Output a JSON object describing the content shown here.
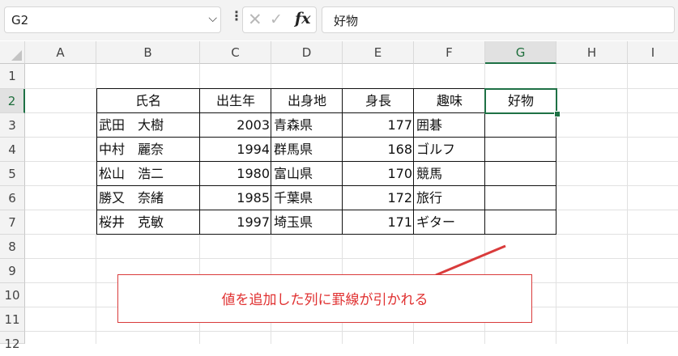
{
  "formula_bar": {
    "name_box": "G2",
    "cancel_icon": "✕",
    "enter_icon": "✓",
    "fx_label": "fx",
    "formula_value": "好物"
  },
  "columns": [
    "A",
    "B",
    "C",
    "D",
    "E",
    "F",
    "G",
    "H",
    "I"
  ],
  "rows": [
    "1",
    "2",
    "3",
    "4",
    "5",
    "6",
    "7",
    "8",
    "9",
    "10",
    "11",
    "12"
  ],
  "selected_cell": "G2",
  "table": {
    "headers": [
      "氏名",
      "出生年",
      "出身地",
      "身長",
      "趣味",
      "好物"
    ],
    "rows": [
      [
        "武田　大樹",
        "2003",
        "青森県",
        "177",
        "囲碁",
        ""
      ],
      [
        "中村　麗奈",
        "1994",
        "群馬県",
        "168",
        "ゴルフ",
        ""
      ],
      [
        "松山　浩二",
        "1980",
        "富山県",
        "170",
        "競馬",
        ""
      ],
      [
        "勝又　奈緒",
        "1985",
        "千葉県",
        "172",
        "旅行",
        ""
      ],
      [
        "桜井　克敏",
        "1997",
        "埼玉県",
        "171",
        "ギター",
        ""
      ]
    ]
  },
  "annotation": {
    "text": "値を追加した列に罫線が引かれる",
    "color": "#e03030"
  },
  "accent_color": "#1e7145"
}
